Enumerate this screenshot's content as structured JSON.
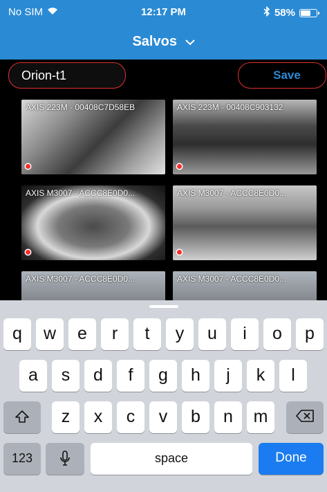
{
  "status_bar": {
    "carrier": "No SIM",
    "time": "12:17 PM",
    "battery": "58%",
    "battery_level": 0.58,
    "icons": [
      "wifi-icon",
      "bluetooth-icon",
      "battery-icon"
    ]
  },
  "nav": {
    "title": "Salvos",
    "chevron_icon": "chevron-down-icon"
  },
  "save_row": {
    "name_value": "Orion-t1",
    "save_label": "Save"
  },
  "cameras": [
    {
      "label": "AXIS 223M - 00408C7D58EB"
    },
    {
      "label": "AXIS 223M - 00408C903132"
    },
    {
      "label": "AXIS M3007 - ACCC8E0D0..."
    },
    {
      "label": "AXIS M3007 - ACCC8E0D0..."
    },
    {
      "label": "AXIS M3007 - ACCC8E0D0..."
    },
    {
      "label": "AXIS M3007 - ACCC8E0D0..."
    }
  ],
  "keyboard": {
    "row1": [
      "q",
      "w",
      "e",
      "r",
      "t",
      "y",
      "u",
      "i",
      "o",
      "p"
    ],
    "row2": [
      "a",
      "s",
      "d",
      "f",
      "g",
      "h",
      "j",
      "k",
      "l"
    ],
    "row3": [
      "z",
      "x",
      "c",
      "v",
      "b",
      "n",
      "m"
    ],
    "numbers_label": "123",
    "space_label": "space",
    "done_label": "Done"
  },
  "colors": {
    "header_blue": "#2a8ad4",
    "highlight_red": "#e03030",
    "done_blue": "#1a7cf0"
  }
}
